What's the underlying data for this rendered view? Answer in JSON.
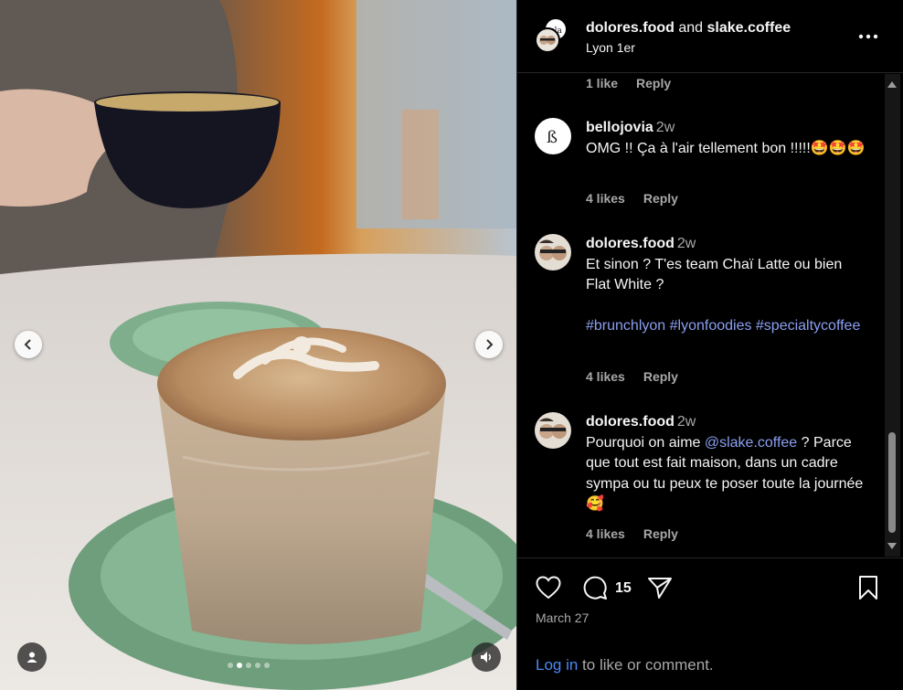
{
  "post": {
    "author": "dolores.food",
    "connector": "and",
    "collaborator": "slake.coffee",
    "location": "Lyon 1er",
    "date": "March 27"
  },
  "media": {
    "carousel_dots": 5,
    "active_dot": 1,
    "icons": [
      "chevron-left-icon",
      "chevron-right-icon",
      "user-tag-icon",
      "volume-icon"
    ]
  },
  "comments": {
    "top_meta": {
      "likes": "1 like",
      "reply": "Reply"
    },
    "items": [
      {
        "user": "bellojovia",
        "time": "2w",
        "text": "OMG !! Ça à l'air tellement bon !!!!!🤩🤩🤩",
        "likes": "4 likes",
        "reply": "Reply"
      },
      {
        "user": "dolores.food",
        "time": "2w",
        "text": "Et sinon ? T'es team Chaï Latte ou bien Flat White ?",
        "hashtags": "#brunchlyon #lyonfoodies #specialtycoffee",
        "likes": "4 likes",
        "reply": "Reply"
      },
      {
        "user": "dolores.food",
        "time": "2w",
        "text_before": "Pourquoi on aime ",
        "mention": "@slake.coffee",
        "text_after": " ? Parce que tout est fait maison, dans un cadre sympa ou tu peux te poser toute la journée 🥰",
        "likes": "4 likes",
        "reply": "Reply"
      }
    ]
  },
  "actions": {
    "comment_count": "15",
    "icons": [
      "heart-icon",
      "comment-icon",
      "share-icon",
      "bookmark-icon"
    ]
  },
  "footer": {
    "login_link": "Log in",
    "login_rest": " to like or comment."
  },
  "colors": {
    "background": "#000000",
    "link": "#8a9ff0",
    "login_link": "#4a8af4",
    "muted": "#a8a8a8"
  }
}
